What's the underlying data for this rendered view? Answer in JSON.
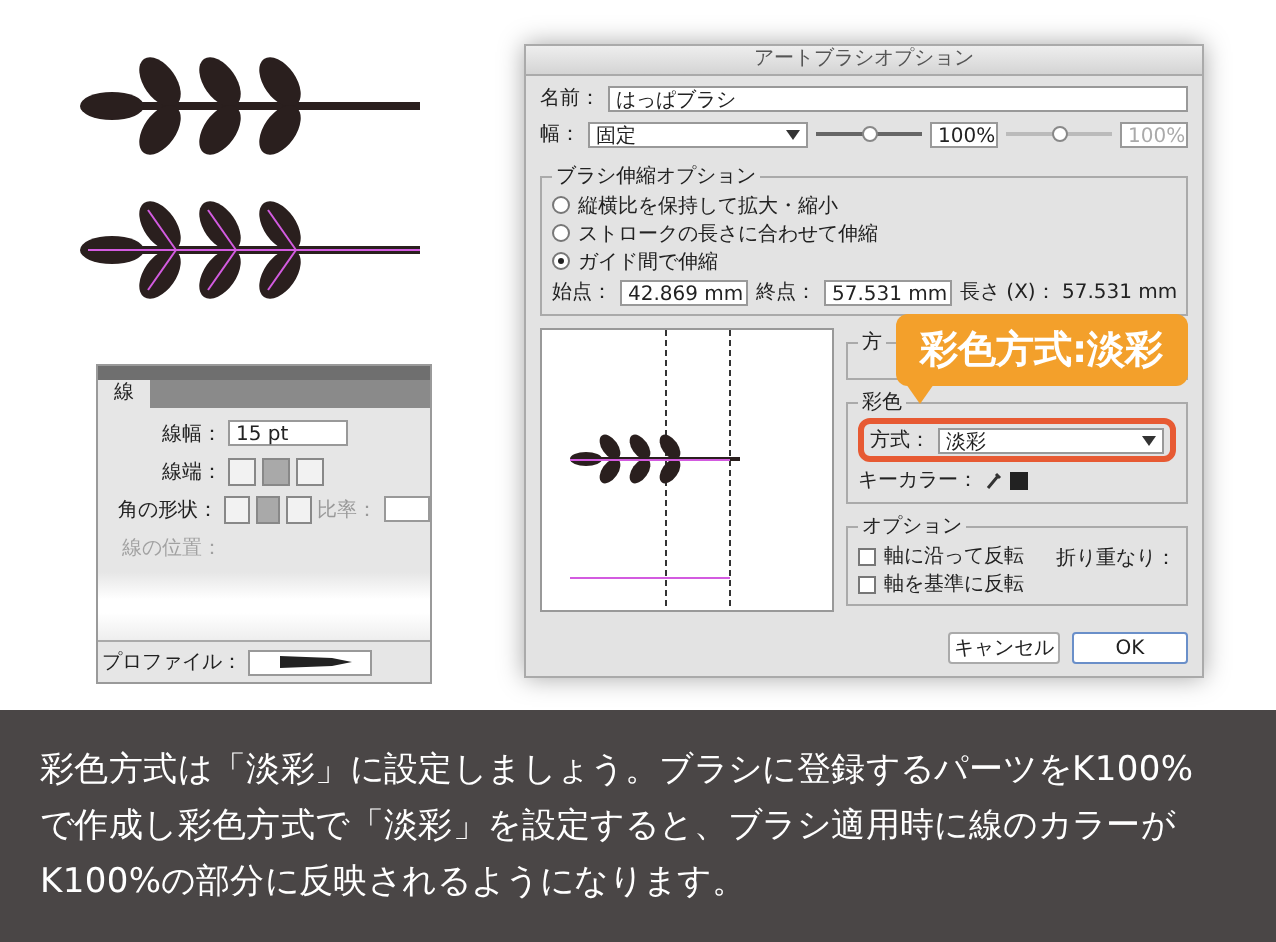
{
  "stroke_panel": {
    "tab": "線",
    "weight_label": "線幅：",
    "weight_value": "15 pt",
    "cap_label": "線端：",
    "cap_buttons": [
      {
        "selected": false
      },
      {
        "selected": true
      },
      {
        "selected": false
      }
    ],
    "corner_label": "角の形状：",
    "corner_buttons": [
      {
        "selected": false
      },
      {
        "selected": true
      },
      {
        "selected": false
      }
    ],
    "ratio_label": "比率：",
    "position_label": "線の位置：",
    "profile_label": "プロファイル："
  },
  "dialog": {
    "title": "アートブラシオプション",
    "name_label": "名前：",
    "name_value": "はっぱブラシ",
    "width_label": "幅：",
    "width_value": "固定",
    "width_percent": "100%",
    "width_slider": {
      "level": 0.5
    },
    "variation_percent": "100%",
    "variation_slider": {
      "level": 0.5
    },
    "scale_group": {
      "title": "ブラシ伸縮オプション",
      "options": [
        {
          "label": "縦横比を保持して拡大・縮小",
          "selected": false
        },
        {
          "label": "ストロークの長さに合わせて伸縮",
          "selected": false
        },
        {
          "label": "ガイド間で伸縮",
          "selected": true
        }
      ],
      "start_label": "始点：",
      "start_value": "42.869 mm",
      "end_label": "終点：",
      "end_value": "57.531 mm",
      "length_text": "長さ (X)： 57.531 mm"
    },
    "direction_group": {
      "title": "方"
    },
    "colorization": {
      "title": "彩色",
      "method_label": "方式：",
      "method_value": "淡彩",
      "key_color_label": "キーカラー："
    },
    "options": {
      "title": "オプション",
      "checkboxes": [
        {
          "label": "軸に沿って反転",
          "checked": false
        },
        {
          "label": "軸を基準に反転",
          "checked": false
        }
      ],
      "overlap_label": "折り重なり："
    },
    "buttons": [
      {
        "label": "キャンセル",
        "default": false
      },
      {
        "label": "OK",
        "default": true
      }
    ]
  },
  "callout": {
    "text": "彩色方式:淡彩"
  },
  "caption": {
    "text": "彩色方式は「淡彩」に設定しましょう。ブラシに登録するパーツをK100%で作成し彩色方式で「淡彩」を設定すると、ブラシ適用時に線のカラーがK100%の部分に反映されるようになります。"
  }
}
